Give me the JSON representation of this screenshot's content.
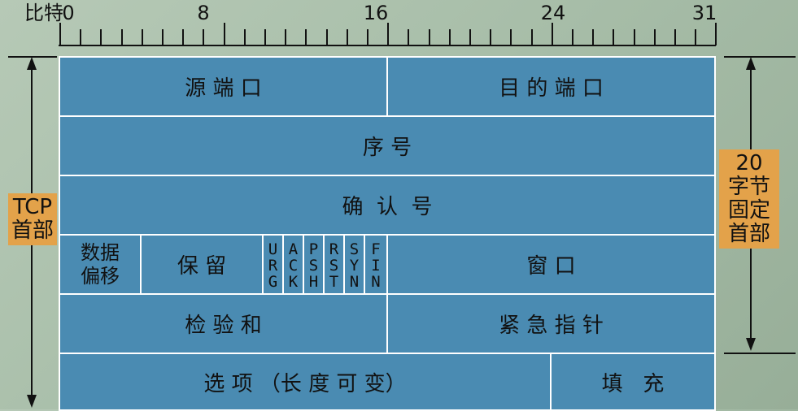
{
  "ruler": {
    "title": "比特",
    "marks": [
      "0",
      "8",
      "16",
      "24",
      "31"
    ]
  },
  "left_label": {
    "line1": "TCP",
    "line2": "首部"
  },
  "right_label": {
    "line1": "20",
    "line2": "字节",
    "line3": "固定",
    "line4": "首部"
  },
  "rows": {
    "r1": {
      "source_port": "源 端 口",
      "dest_port": "目 的 端 口"
    },
    "r2": {
      "seq": "序 号"
    },
    "r3": {
      "ack": "确  认  号"
    },
    "r4": {
      "data_offset_1": "数据",
      "data_offset_2": "偏移",
      "reserved": "保 留",
      "flags": [
        [
          "U",
          "R",
          "G"
        ],
        [
          "A",
          "C",
          "K"
        ],
        [
          "P",
          "S",
          "H"
        ],
        [
          "R",
          "S",
          "T"
        ],
        [
          "S",
          "Y",
          "N"
        ],
        [
          "F",
          "I",
          "N"
        ]
      ],
      "window": "窗 口"
    },
    "r5": {
      "checksum": "检 验 和",
      "urgent": "紧 急 指 针"
    },
    "r6": {
      "options": "选 项 （长 度 可 变）",
      "padding": "填   充"
    }
  },
  "colors": {
    "cell": "#4a8bb2",
    "label_bg": "#e3a24a",
    "background": "#a8bea9"
  }
}
